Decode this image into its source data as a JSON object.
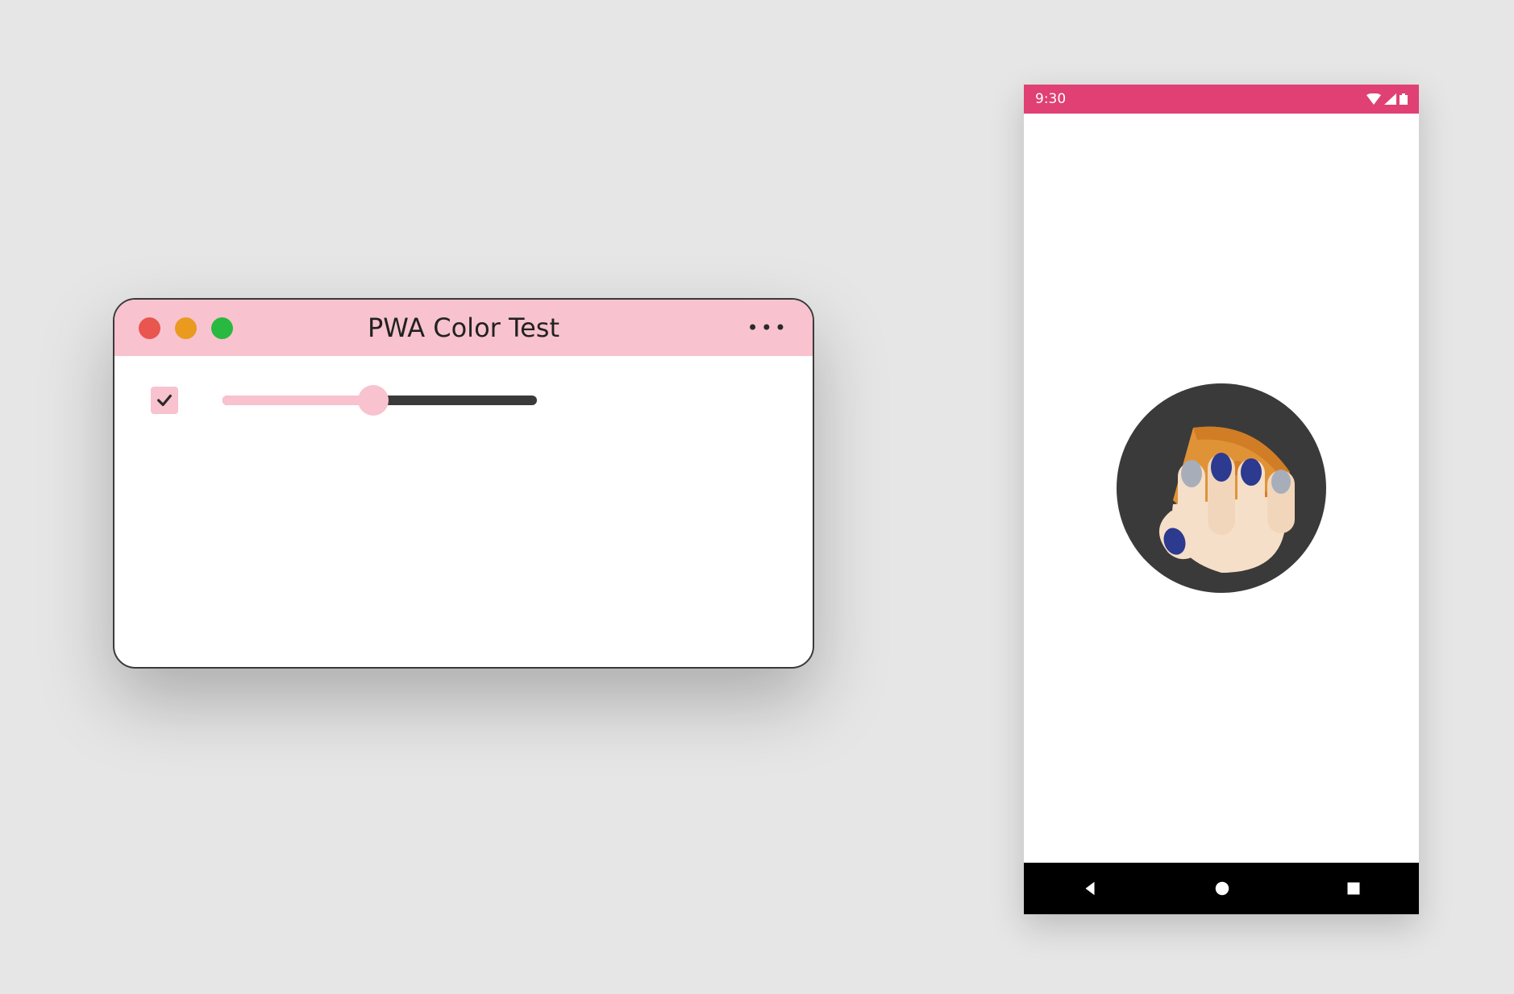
{
  "colors": {
    "theme_pink": "#f8c2cf",
    "accent_magenta": "#e04074",
    "window_border": "#3a3a3a",
    "canvas": "#e6e6e6"
  },
  "desktop_window": {
    "title": "PWA Color Test",
    "traffic_lights": {
      "close": "close",
      "minimize": "minimize",
      "maximize": "maximize"
    },
    "overflow_glyph": "•••",
    "checkbox_checked": true,
    "slider_percent": 48
  },
  "mobile": {
    "status_time": "9:30",
    "status_icons": {
      "wifi": "wifi-icon",
      "signal": "signal-icon",
      "battery": "battery-icon"
    },
    "app_icon_name": "hand-crushing-pizza-icon",
    "nav": {
      "back": "back-icon",
      "home": "home-icon",
      "recents": "recents-icon"
    }
  }
}
